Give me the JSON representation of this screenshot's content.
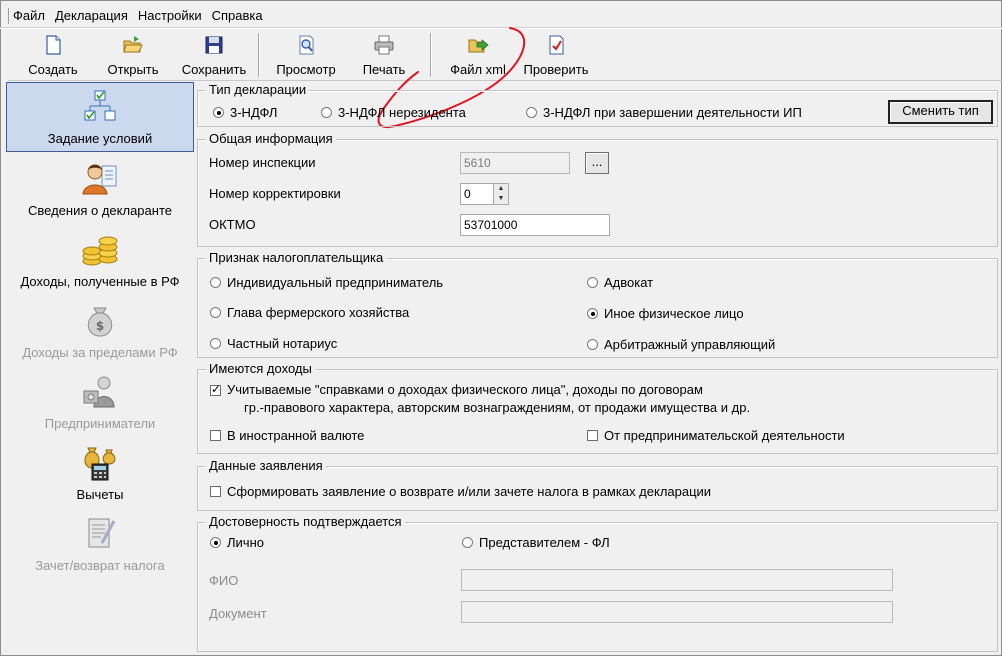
{
  "menu": [
    "Файл",
    "Декларация",
    "Настройки",
    "Справка"
  ],
  "toolbar": {
    "create": "Создать",
    "open": "Открыть",
    "save": "Сохранить",
    "preview": "Просмотр",
    "print": "Печать",
    "xml": "Файл xml",
    "check": "Проверить"
  },
  "nav": [
    {
      "label": "Задание условий",
      "state": "selected"
    },
    {
      "label": "Сведения о декларанте",
      "state": "enabled"
    },
    {
      "label": "Доходы, полученные в РФ",
      "state": "enabled"
    },
    {
      "label": "Доходы за пределами РФ",
      "state": "disabled"
    },
    {
      "label": "Предприниматели",
      "state": "disabled"
    },
    {
      "label": "Вычеты",
      "state": "enabled"
    },
    {
      "label": "Зачет/возврат налога",
      "state": "disabled"
    }
  ],
  "decl_type": {
    "title": "Тип декларации",
    "options": [
      "3-НДФЛ",
      "3-НДФЛ нерезидента",
      "3-НДФЛ при завершении деятельности ИП"
    ],
    "selected": 0,
    "change_button": "Сменить тип"
  },
  "general": {
    "title": "Общая информация",
    "inspection_label": "Номер инспекции",
    "inspection_value": "5610",
    "browse_button": "...",
    "correction_label": "Номер корректировки",
    "correction_value": "0",
    "oktmo_label": "ОКТМО",
    "oktmo_value": "53701000"
  },
  "taxpayer": {
    "title": "Признак налогоплательщика",
    "options": [
      "Индивидуальный предприниматель",
      "Глава фермерского хозяйства",
      "Частный нотариус",
      "Адвокат",
      "Иное физическое лицо",
      "Арбитражный управляющий"
    ],
    "selected": 4
  },
  "incomes": {
    "title": "Имеются доходы",
    "cert_line1": "Учитываемые \"справками о доходах физического лица\", доходы по договорам",
    "cert_line2": "гр.-правового характера, авторским вознаграждениям, от продажи имущества и др.",
    "cert_checked": true,
    "foreign": "В иностранной валюте",
    "foreign_checked": false,
    "business": "От предпринимательской деятельности",
    "business_checked": false
  },
  "statement": {
    "title": "Данные заявления",
    "label": "Сформировать заявление о  возврате и/или зачете налога в рамках декларации",
    "checked": false
  },
  "confirm": {
    "title": "Достоверность подтверждается",
    "personal": "Лично",
    "representative": "Представителем - ФЛ",
    "selected": 0,
    "fio_label": "ФИО",
    "doc_label": "Документ",
    "fio_value": "",
    "doc_value": ""
  },
  "colors": {
    "window_bg": "#f0f0f0",
    "selected_nav_bg": "#ccd8ee",
    "selected_nav_border": "#3f5b92",
    "disabled_text": "#9a9a9a",
    "annotation_red": "#e0141e"
  }
}
